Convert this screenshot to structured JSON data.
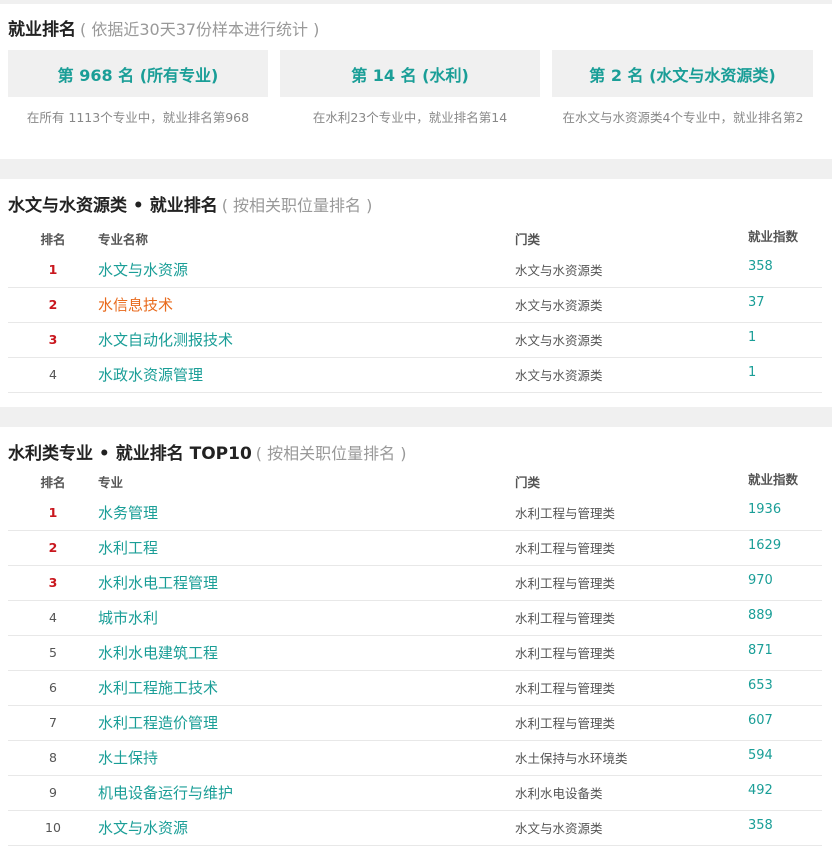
{
  "summary": {
    "title": "就业排名",
    "subtitle": "( 依据近30天37份样本进行统计 )",
    "cards": [
      {
        "label": "第 968 名 (所有专业)",
        "caption": "在所有 1113个专业中，就业排名第968"
      },
      {
        "label": "第 14 名 (水利)",
        "caption": "在水利23个专业中，就业排名第14"
      },
      {
        "label": "第 2 名 (水文与水资源类)",
        "caption": "在水文与水资源类4个专业中，就业排名第2"
      }
    ]
  },
  "category_ranking": {
    "title": "水文与水资源类 • 就业排名",
    "subtitle": "( 按相关职位量排名 )",
    "headers": {
      "rank": "排名",
      "name": "专业名称",
      "category": "门类",
      "index": "就业指数"
    },
    "rows": [
      {
        "rank": "1",
        "name": "水文与水资源",
        "category": "水文与水资源类",
        "index": "358"
      },
      {
        "rank": "2",
        "name": "水信息技术",
        "category": "水文与水资源类",
        "index": "37"
      },
      {
        "rank": "3",
        "name": "水文自动化测报技术",
        "category": "水文与水资源类",
        "index": "1"
      },
      {
        "rank": "4",
        "name": "水政水资源管理",
        "category": "水文与水资源类",
        "index": "1"
      }
    ]
  },
  "top10_ranking": {
    "title": "水利类专业 • 就业排名 TOP10",
    "subtitle": "( 按相关职位量排名 )",
    "headers": {
      "rank": "排名",
      "name": "专业",
      "category": "门类",
      "index": "就业指数"
    },
    "rows": [
      {
        "rank": "1",
        "name": "水务管理",
        "category": "水利工程与管理类",
        "index": "1936"
      },
      {
        "rank": "2",
        "name": "水利工程",
        "category": "水利工程与管理类",
        "index": "1629"
      },
      {
        "rank": "3",
        "name": "水利水电工程管理",
        "category": "水利工程与管理类",
        "index": "970"
      },
      {
        "rank": "4",
        "name": "城市水利",
        "category": "水利工程与管理类",
        "index": "889"
      },
      {
        "rank": "5",
        "name": "水利水电建筑工程",
        "category": "水利工程与管理类",
        "index": "871"
      },
      {
        "rank": "6",
        "name": "水利工程施工技术",
        "category": "水利工程与管理类",
        "index": "653"
      },
      {
        "rank": "7",
        "name": "水利工程造价管理",
        "category": "水利工程与管理类",
        "index": "607"
      },
      {
        "rank": "8",
        "name": "水土保持",
        "category": "水土保持与水环境类",
        "index": "594"
      },
      {
        "rank": "9",
        "name": "机电设备运行与维护",
        "category": "水利水电设备类",
        "index": "492"
      },
      {
        "rank": "10",
        "name": "水文与水资源",
        "category": "水文与水资源类",
        "index": "358"
      }
    ]
  }
}
